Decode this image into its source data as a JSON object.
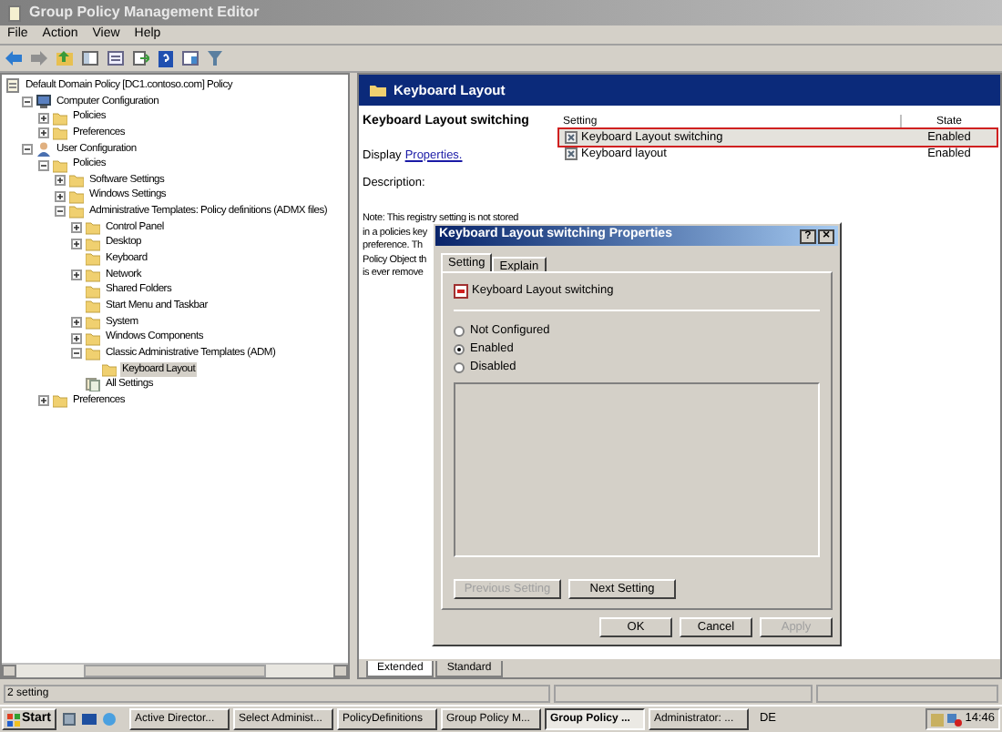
{
  "window": {
    "title": "Group Policy Management Editor"
  },
  "menu": [
    "File",
    "Action",
    "View",
    "Help"
  ],
  "tree": [
    {
      "label": "Default Domain Policy [DC1.contoso.com] Policy",
      "kind": "policy",
      "selected": false,
      "children": [
        {
          "label": "Computer Configuration",
          "kind": "computer",
          "expanded": true,
          "selected": false,
          "children": [
            {
              "label": "Policies",
              "kind": "folder",
              "expanded": false,
              "selected": false
            },
            {
              "label": "Preferences",
              "kind": "folder",
              "expanded": false,
              "selected": false
            }
          ]
        },
        {
          "label": "User Configuration",
          "kind": "user",
          "expanded": true,
          "selected": false,
          "children": [
            {
              "label": "Policies",
              "kind": "folder",
              "expanded": true,
              "selected": false,
              "children": [
                {
                  "label": "Software Settings",
                  "kind": "folder",
                  "expanded": false,
                  "selected": false
                },
                {
                  "label": "Windows Settings",
                  "kind": "folder",
                  "expanded": false,
                  "selected": false
                },
                {
                  "label": "Administrative Templates: Policy definitions (ADMX files)",
                  "kind": "folder",
                  "expanded": true,
                  "selected": false,
                  "children": [
                    {
                      "label": "Control Panel",
                      "kind": "folder",
                      "expanded": false,
                      "selected": false
                    },
                    {
                      "label": "Desktop",
                      "kind": "folder",
                      "expanded": false,
                      "selected": false
                    },
                    {
                      "label": "Keyboard",
                      "kind": "folder",
                      "selected": false
                    },
                    {
                      "label": "Network",
                      "kind": "folder",
                      "expanded": false,
                      "selected": false
                    },
                    {
                      "label": "Shared Folders",
                      "kind": "folder",
                      "selected": false
                    },
                    {
                      "label": "Start Menu and Taskbar",
                      "kind": "folder",
                      "selected": false
                    },
                    {
                      "label": "System",
                      "kind": "folder",
                      "expanded": false,
                      "selected": false
                    },
                    {
                      "label": "Windows Components",
                      "kind": "folder",
                      "expanded": false,
                      "selected": false
                    },
                    {
                      "label": "Classic Administrative Templates (ADM)",
                      "kind": "folder",
                      "expanded": true,
                      "selected": false,
                      "children": [
                        {
                          "label": "Keyboard Layout",
                          "kind": "folder",
                          "selected": true
                        }
                      ]
                    },
                    {
                      "label": "All Settings",
                      "kind": "settings",
                      "selected": false
                    }
                  ]
                }
              ]
            },
            {
              "label": "Preferences",
              "kind": "folder",
              "expanded": false,
              "selected": false
            }
          ]
        }
      ]
    }
  ],
  "details": {
    "header": "Keyboard Layout",
    "title": "Keyboard Layout switching",
    "display_label": "Display",
    "display_link": "Properties.",
    "description_label": "Description:",
    "note_lines": [
      "Note:  This registry setting is not stored",
      "in a policies key",
      "preference.  Th",
      "Policy Object th",
      "is ever remove"
    ]
  },
  "settings_table": {
    "columns": [
      "Setting",
      "State"
    ],
    "rows": [
      {
        "setting": "Keyboard Layout switching",
        "state": "Enabled",
        "selected": true
      },
      {
        "setting": "Keyboard layout",
        "state": "Enabled",
        "selected": false
      }
    ]
  },
  "view_tabs": [
    {
      "label": "Extended",
      "selected": true
    },
    {
      "label": "Standard",
      "selected": false
    }
  ],
  "status_bar": "2 setting",
  "dialog": {
    "title": "Keyboard Layout switching Properties",
    "help": "?",
    "close": "×",
    "tabs": [
      {
        "label": "Setting",
        "selected": true
      },
      {
        "label": "Explain",
        "selected": false
      }
    ],
    "policy_name": "Keyboard Layout switching",
    "options": [
      {
        "label": "Not Configured",
        "selected": false
      },
      {
        "label": "Enabled",
        "selected": true
      },
      {
        "label": "Disabled",
        "selected": false
      }
    ],
    "nav_buttons": [
      {
        "label": "Previous Setting",
        "disabled": true
      },
      {
        "label": "Next Setting",
        "disabled": false
      }
    ],
    "buttons": [
      {
        "label": "OK",
        "disabled": false
      },
      {
        "label": "Cancel",
        "disabled": false
      },
      {
        "label": "Apply",
        "disabled": true
      }
    ]
  },
  "taskbar": {
    "start": "Start",
    "tasks": [
      {
        "label": "Active Director...",
        "selected": false
      },
      {
        "label": "Select Administ...",
        "selected": false
      },
      {
        "label": "PolicyDefinitions",
        "selected": false
      },
      {
        "label": "Group Policy M...",
        "selected": false
      },
      {
        "label": "Group Policy ...",
        "selected": true
      },
      {
        "label": "Administrator: ...",
        "selected": false
      }
    ],
    "language": "DE",
    "clock": "14:46"
  }
}
